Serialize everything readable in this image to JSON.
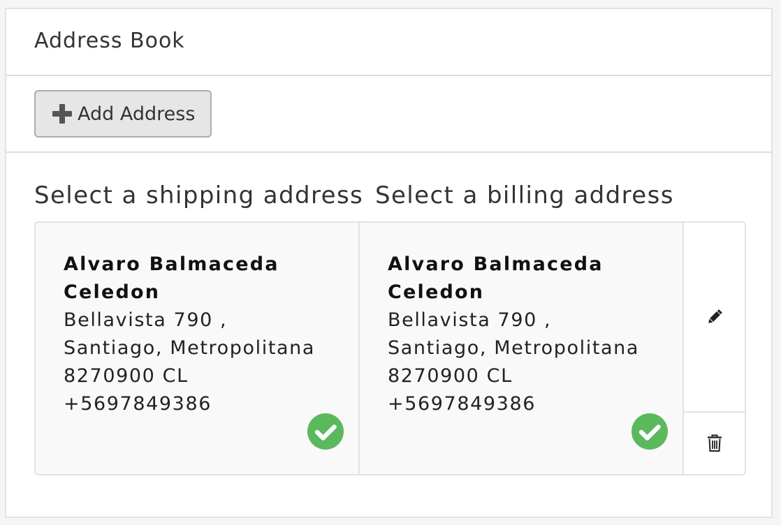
{
  "panel": {
    "title": "Address Book"
  },
  "toolbar": {
    "add_icon": "plus-icon",
    "add_label": "Add Address"
  },
  "headings": {
    "shipping": "Select a shipping address",
    "billing": "Select a billing address"
  },
  "addresses": {
    "shipping": {
      "name_line1": "Alvaro Balmaceda",
      "name_line2": "Celedon",
      "street": "Bellavista 790 ,",
      "city_region": "Santiago, Metropolitana",
      "postal_country": "8270900 CL",
      "phone": "+5697849386",
      "selected": true,
      "status_icon": "check-circle-icon"
    },
    "billing": {
      "name_line1": "Alvaro Balmaceda",
      "name_line2": "Celedon",
      "street": "Bellavista 790 ,",
      "city_region": "Santiago, Metropolitana",
      "postal_country": "8270900 CL",
      "phone": "+5697849386",
      "selected": true,
      "status_icon": "check-circle-icon"
    }
  },
  "actions": {
    "edit_icon": "pencil-icon",
    "delete_icon": "trash-icon"
  },
  "colors": {
    "selected_check": "#5cb85c",
    "button_bg": "#e6e6e6",
    "card_bg": "#f9f9f9"
  }
}
